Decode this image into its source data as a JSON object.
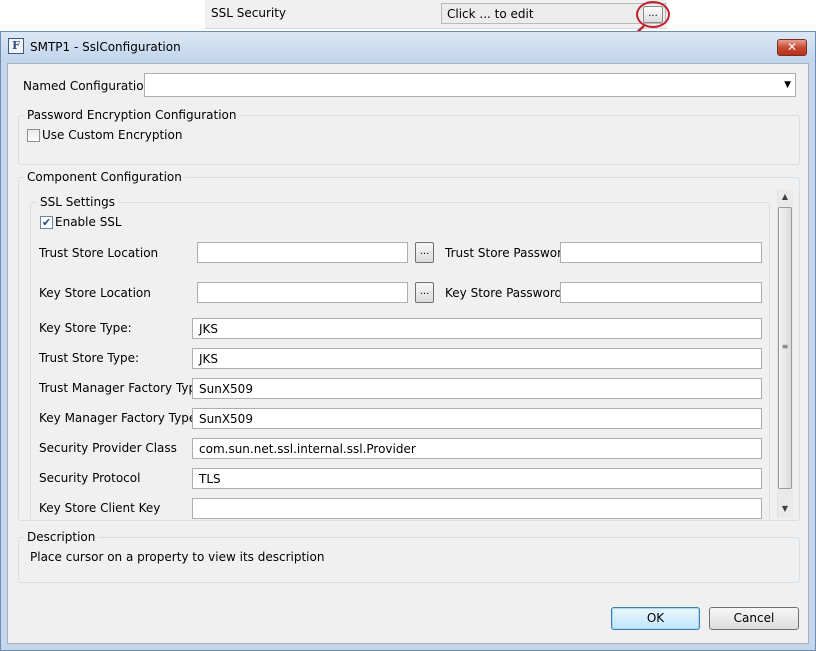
{
  "property_row": {
    "label": "SSL Security",
    "value": "Click ... to edit",
    "button": "..."
  },
  "dialog": {
    "title": "SMTP1 - SslConfiguration",
    "app_icon": "F",
    "close_glyph": "✕"
  },
  "named_configuration": {
    "label": "Named Configuration",
    "value": "",
    "arrow": "▼"
  },
  "password_encryption": {
    "title": "Password Encryption Configuration",
    "use_custom_label": "Use Custom Encryption",
    "use_custom_checked": false
  },
  "component_configuration": {
    "title": "Component Configuration",
    "ssl_settings_title": "SSL Settings",
    "enable_ssl_label": "Enable SSL",
    "enable_ssl_checked": true,
    "check_glyph": "✔",
    "browse_button": "...",
    "trust_store_location": {
      "label": "Trust Store Location",
      "value": ""
    },
    "trust_store_password": {
      "label": "Trust Store Password",
      "value": ""
    },
    "key_store_location": {
      "label": "Key Store Location",
      "value": ""
    },
    "key_store_password": {
      "label": "Key Store Password",
      "value": ""
    },
    "key_store_type": {
      "label": "Key Store Type:",
      "value": "JKS"
    },
    "trust_store_type": {
      "label": "Trust Store Type:",
      "value": "JKS"
    },
    "trust_manager_factory_type": {
      "label": "Trust Manager Factory Type",
      "value": "SunX509"
    },
    "key_manager_factory_type": {
      "label": "Key Manager Factory Type",
      "value": "SunX509"
    },
    "security_provider_class": {
      "label": "Security Provider Class",
      "value": "com.sun.net.ssl.internal.ssl.Provider"
    },
    "security_protocol": {
      "label": "Security Protocol",
      "value": "TLS"
    },
    "key_store_client_key": {
      "label": "Key Store Client Key",
      "value": ""
    },
    "scrollbar": {
      "up": "▲",
      "down": "▼",
      "grip": "≡"
    }
  },
  "description": {
    "title": "Description",
    "text": "Place cursor on a property to view its description"
  },
  "buttons": {
    "ok": "OK",
    "cancel": "Cancel"
  },
  "colors": {
    "annotation_red": "#c0202a",
    "window_frame": "#c6d6ea",
    "client_bg": "#f0f0f0",
    "default_button": "#bee6fd"
  }
}
